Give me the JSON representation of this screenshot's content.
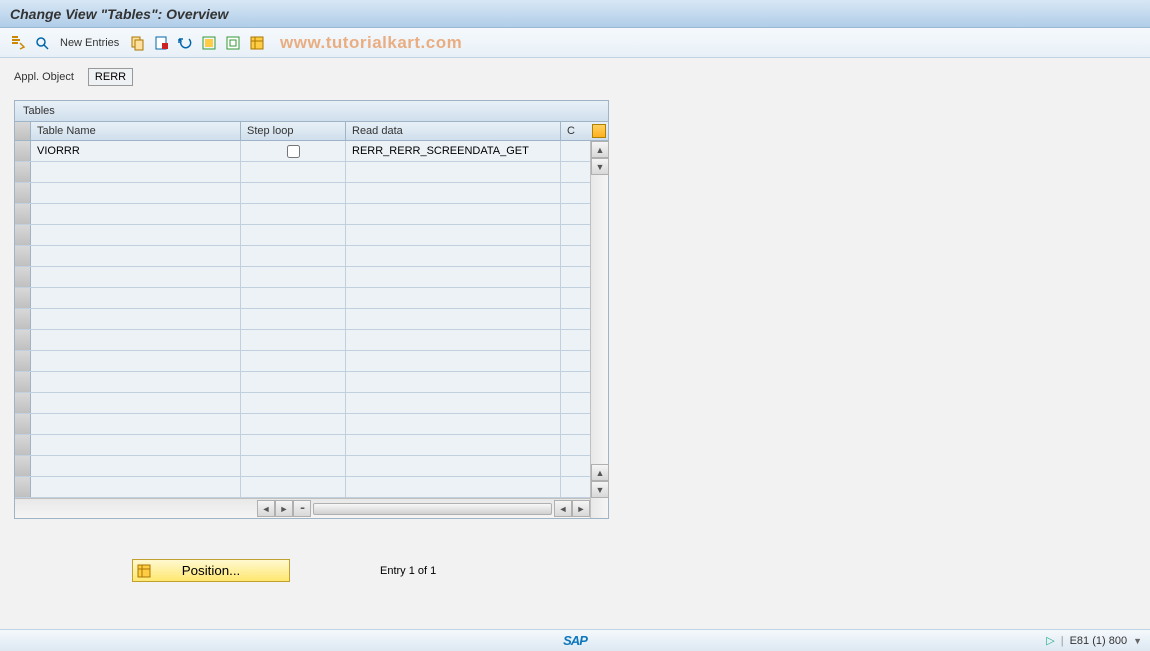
{
  "title": "Change View \"Tables\": Overview",
  "toolbar": {
    "new_entries": "New Entries"
  },
  "watermark": "www.tutorialkart.com",
  "fields": {
    "appl_object_label": "Appl. Object",
    "appl_object_value": "RERR"
  },
  "table": {
    "title": "Tables",
    "columns": {
      "name": "Table Name",
      "step": "Step loop",
      "read": "Read data",
      "c": "C"
    },
    "rows": [
      {
        "name": "VIORRR",
        "step_loop": false,
        "read_data": "RERR_RERR_SCREENDATA_GET"
      }
    ],
    "empty_rows": 16
  },
  "position": {
    "label": "Position...",
    "entry_info": "Entry 1 of 1"
  },
  "status_bar": {
    "system": "E81 (1) 800"
  }
}
